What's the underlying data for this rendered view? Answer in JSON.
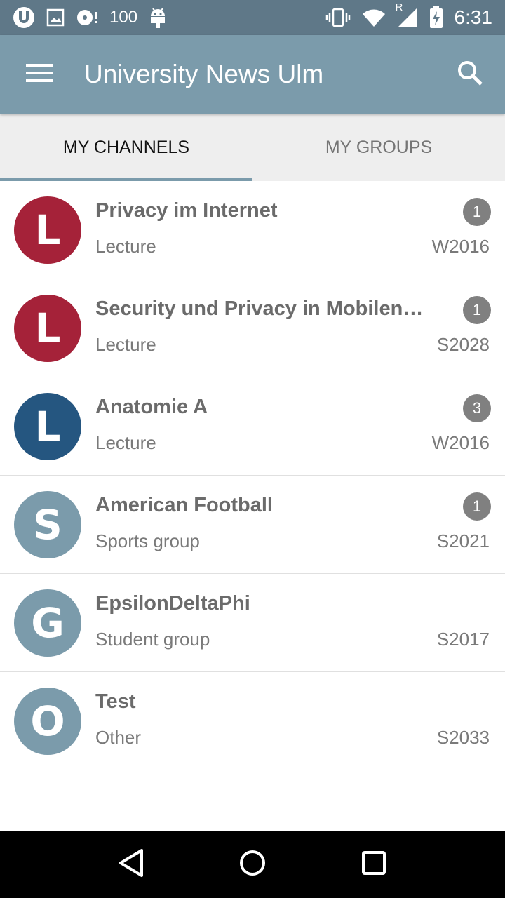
{
  "status_bar": {
    "notification_count": "100",
    "time": "6:31",
    "signal_label": "R"
  },
  "app_bar": {
    "title": "University News Ulm"
  },
  "tabs": [
    {
      "label": "MY CHANNELS",
      "active": true
    },
    {
      "label": "MY GROUPS",
      "active": false
    }
  ],
  "channels": [
    {
      "letter": "L",
      "title": "Privacy im Internet",
      "type": "Lecture",
      "term": "W2016",
      "badge": "1",
      "color": "#a52239"
    },
    {
      "letter": "L",
      "title": "Security und Privacy in Mobilen…",
      "type": "Lecture",
      "term": "S2028",
      "badge": "1",
      "color": "#a52239"
    },
    {
      "letter": "L",
      "title": "Anatomie A",
      "type": "Lecture",
      "term": "W2016",
      "badge": "3",
      "color": "#255680"
    },
    {
      "letter": "S",
      "title": "American Football",
      "type": "Sports group",
      "term": "S2021",
      "badge": "1",
      "color": "#7b9bab"
    },
    {
      "letter": "G",
      "title": "EpsilonDeltaPhi",
      "type": "Student group",
      "term": "S2017",
      "badge": "",
      "color": "#7b9bab"
    },
    {
      "letter": "O",
      "title": "Test",
      "type": "Other",
      "term": "S2033",
      "badge": "",
      "color": "#7b9bab"
    }
  ],
  "colors": {
    "status_bar": "#5f7888",
    "app_bar": "#7b9bab",
    "lecture": "#a52239",
    "anatomy": "#255680",
    "group": "#7b9bab"
  }
}
